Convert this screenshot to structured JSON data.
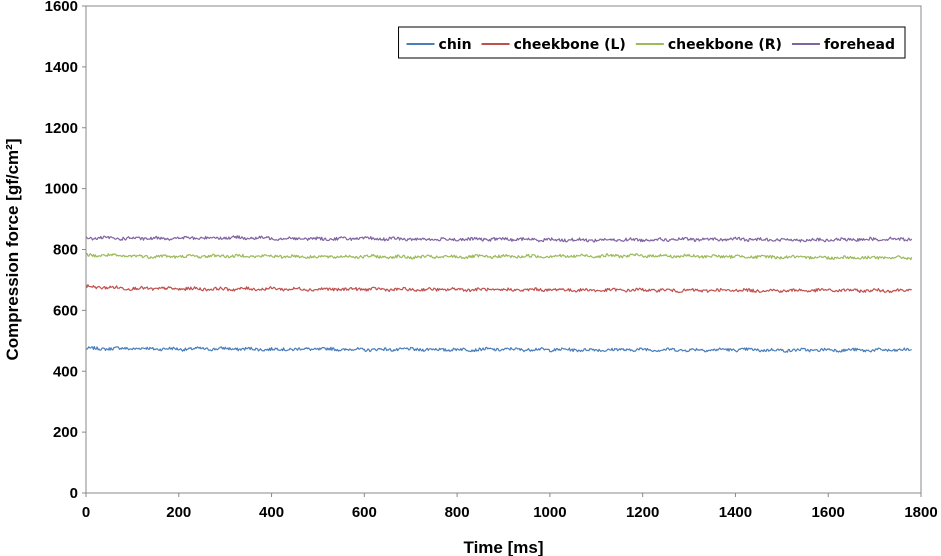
{
  "chart_data": {
    "type": "line",
    "title": "",
    "xlabel": "Time [ms]",
    "ylabel": "Compression force [gf/cm²]",
    "xlim": [
      0,
      1800
    ],
    "ylim": [
      0,
      1600
    ],
    "xticks": [
      0,
      200,
      400,
      600,
      800,
      1000,
      1200,
      1400,
      1600,
      1800
    ],
    "yticks": [
      0,
      200,
      400,
      600,
      800,
      1000,
      1200,
      1400,
      1600
    ],
    "grid": false,
    "legend_position": "top-right",
    "series": [
      {
        "name": "chin",
        "color": "#4a7ebb",
        "x": [
          0,
          100,
          200,
          300,
          400,
          500,
          600,
          700,
          800,
          900,
          1000,
          1100,
          1200,
          1300,
          1400,
          1500,
          1600,
          1700,
          1780
        ],
        "values": [
          474,
          475,
          473,
          474,
          472,
          473,
          471,
          472,
          471,
          472,
          471,
          470,
          471,
          470,
          471,
          469,
          470,
          469,
          470
        ]
      },
      {
        "name": "cheekbone (L)",
        "color": "#c0504d",
        "x": [
          0,
          100,
          200,
          300,
          400,
          500,
          600,
          700,
          800,
          900,
          1000,
          1100,
          1200,
          1300,
          1400,
          1500,
          1600,
          1700,
          1780
        ],
        "values": [
          678,
          672,
          671,
          670,
          671,
          669,
          670,
          668,
          669,
          667,
          668,
          666,
          667,
          665,
          666,
          665,
          666,
          665,
          666
        ]
      },
      {
        "name": "cheekbone (R)",
        "color": "#9bbb59",
        "x": [
          0,
          100,
          200,
          300,
          400,
          500,
          600,
          700,
          800,
          900,
          1000,
          1100,
          1200,
          1300,
          1400,
          1500,
          1600,
          1700,
          1780
        ],
        "values": [
          782,
          778,
          777,
          779,
          778,
          776,
          777,
          775,
          776,
          777,
          778,
          779,
          780,
          778,
          777,
          775,
          774,
          773,
          773
        ]
      },
      {
        "name": "forehead",
        "color": "#8064a2",
        "x": [
          0,
          100,
          200,
          300,
          400,
          500,
          600,
          700,
          800,
          900,
          1000,
          1100,
          1200,
          1300,
          1400,
          1500,
          1600,
          1700,
          1780
        ],
        "values": [
          838,
          836,
          837,
          839,
          837,
          835,
          836,
          834,
          833,
          834,
          832,
          831,
          832,
          833,
          834,
          832,
          831,
          834,
          835
        ]
      }
    ]
  }
}
